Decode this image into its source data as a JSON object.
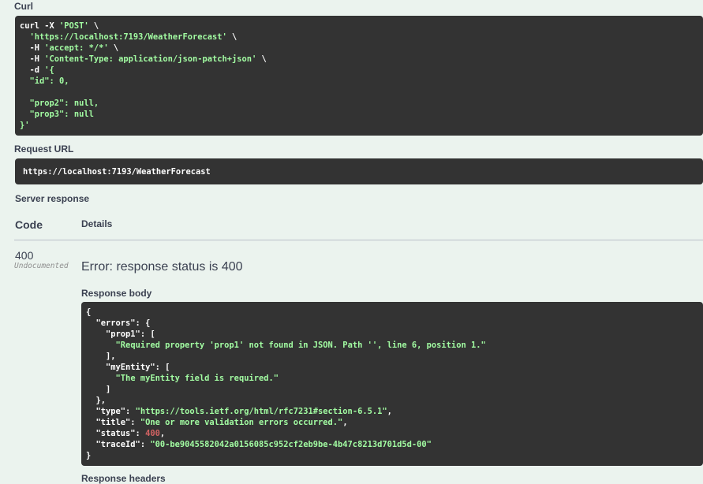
{
  "curl": {
    "label": "Curl",
    "lines": [
      {
        "parts": [
          {
            "t": "curl -X ",
            "c": "plain"
          },
          {
            "t": "'POST'",
            "c": "str"
          },
          {
            "t": " \\",
            "c": "plain"
          }
        ]
      },
      {
        "parts": [
          {
            "t": "  ",
            "c": "plain"
          },
          {
            "t": "'https://localhost:7193/WeatherForecast'",
            "c": "str"
          },
          {
            "t": " \\",
            "c": "plain"
          }
        ]
      },
      {
        "parts": [
          {
            "t": "  -H ",
            "c": "plain"
          },
          {
            "t": "'accept: */*'",
            "c": "str"
          },
          {
            "t": " \\",
            "c": "plain"
          }
        ]
      },
      {
        "parts": [
          {
            "t": "  -H ",
            "c": "plain"
          },
          {
            "t": "'Content-Type: application/json-patch+json'",
            "c": "str"
          },
          {
            "t": " \\",
            "c": "plain"
          }
        ]
      },
      {
        "parts": [
          {
            "t": "  -d ",
            "c": "plain"
          },
          {
            "t": "'{",
            "c": "str"
          }
        ]
      },
      {
        "parts": [
          {
            "t": "  \"id\": 0,",
            "c": "str"
          }
        ]
      },
      {
        "parts": [
          {
            "t": "",
            "c": "plain"
          }
        ]
      },
      {
        "parts": [
          {
            "t": "  \"prop2\": null,",
            "c": "str"
          }
        ]
      },
      {
        "parts": [
          {
            "t": "  \"prop3\": null",
            "c": "str"
          }
        ]
      },
      {
        "parts": [
          {
            "t": "}'",
            "c": "str"
          }
        ]
      }
    ]
  },
  "request_url": {
    "label": "Request URL",
    "value": "https://localhost:7193/WeatherForecast"
  },
  "server_response": {
    "label": "Server response",
    "col_code": "Code",
    "col_details": "Details",
    "code": "400",
    "undocumented": "Undocumented",
    "error_text": "Error: response status is 400",
    "body_label": "Response body",
    "body_lines": [
      {
        "parts": [
          {
            "t": "{",
            "c": "plain"
          }
        ]
      },
      {
        "parts": [
          {
            "t": "  \"errors\": {",
            "c": "plain"
          }
        ]
      },
      {
        "parts": [
          {
            "t": "    \"prop1\": [",
            "c": "plain"
          }
        ]
      },
      {
        "parts": [
          {
            "t": "      ",
            "c": "plain"
          },
          {
            "t": "\"Required property 'prop1' not found in JSON. Path '', line 6, position 1.\"",
            "c": "str"
          }
        ]
      },
      {
        "parts": [
          {
            "t": "    ],",
            "c": "plain"
          }
        ]
      },
      {
        "parts": [
          {
            "t": "    \"myEntity\": [",
            "c": "plain"
          }
        ]
      },
      {
        "parts": [
          {
            "t": "      ",
            "c": "plain"
          },
          {
            "t": "\"The myEntity field is required.\"",
            "c": "str"
          }
        ]
      },
      {
        "parts": [
          {
            "t": "    ]",
            "c": "plain"
          }
        ]
      },
      {
        "parts": [
          {
            "t": "  },",
            "c": "plain"
          }
        ]
      },
      {
        "parts": [
          {
            "t": "  \"type\": ",
            "c": "plain"
          },
          {
            "t": "\"https://tools.ietf.org/html/rfc7231#section-6.5.1\"",
            "c": "str"
          },
          {
            "t": ",",
            "c": "plain"
          }
        ]
      },
      {
        "parts": [
          {
            "t": "  \"title\": ",
            "c": "plain"
          },
          {
            "t": "\"One or more validation errors occurred.\"",
            "c": "str"
          },
          {
            "t": ",",
            "c": "plain"
          }
        ]
      },
      {
        "parts": [
          {
            "t": "  \"status\": ",
            "c": "plain"
          },
          {
            "t": "400",
            "c": "num"
          },
          {
            "t": ",",
            "c": "plain"
          }
        ]
      },
      {
        "parts": [
          {
            "t": "  \"traceId\": ",
            "c": "plain"
          },
          {
            "t": "\"00-be9045582042a0156085c952cf2eb9be-4b47c8213d701d5d-00\"",
            "c": "str"
          }
        ]
      },
      {
        "parts": [
          {
            "t": "}",
            "c": "plain"
          }
        ]
      }
    ],
    "headers_label": "Response headers"
  },
  "colors": {
    "background": "#ebf3ee",
    "code_bg": "#333333",
    "string": "#a2fca2",
    "number": "#d36363",
    "text": "#3b4151"
  }
}
